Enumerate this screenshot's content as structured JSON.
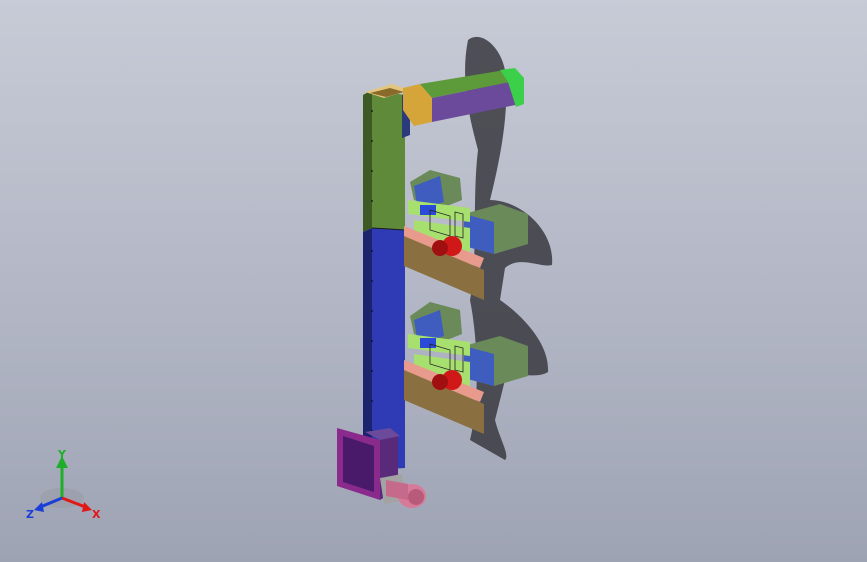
{
  "viewport": {
    "background_top": "#c7cbd6",
    "background_bottom": "#9ea3b4"
  },
  "triad": {
    "x_label": "X",
    "y_label": "Y",
    "z_label": "Z",
    "x_color": "#e01818",
    "y_color": "#1fae2a",
    "z_color": "#1a3fd6"
  },
  "model": {
    "description_icons": [
      "vertical-elevator-column",
      "top-discharge-chute",
      "feed-hopper",
      "drive-motor",
      "side-modules"
    ],
    "colors": {
      "column_upper": "#5f8a3a",
      "column_lower": "#2f3bb5",
      "chute": "#6b4a9c",
      "chute_end": "#3cd04a",
      "head_box": "#d6a53a",
      "hopper": "#8a2a8c",
      "motor": "#d77a9a",
      "module_duct": "#6a8a5a",
      "module_blue": "#3f5dbf",
      "module_red": "#d01818",
      "module_pink": "#e89a8c",
      "module_green": "#a8e070",
      "shadow": "#3a3a3f"
    }
  }
}
